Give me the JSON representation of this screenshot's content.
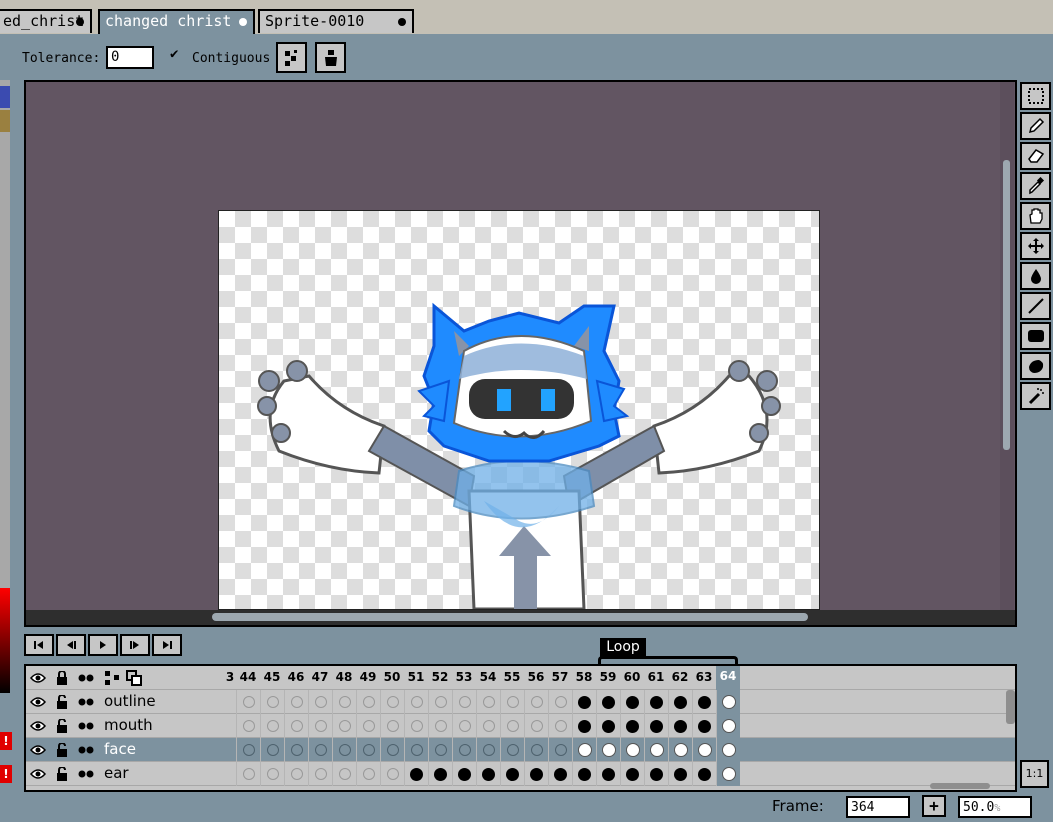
{
  "tabs": [
    {
      "label": "ed_christ",
      "modified": true
    },
    {
      "label": "changed christ",
      "modified": true,
      "active": true
    },
    {
      "label": "Sprite-0010",
      "modified": true
    }
  ],
  "toolbar": {
    "tolerance_label": "Tolerance:",
    "tolerance_value": "0",
    "contiguous_checked": true,
    "contiguous_label": "Contiguous",
    "contiguous_mark": "✔"
  },
  "tools": [
    "rectangular-marquee",
    "pencil",
    "eraser",
    "eyedropper",
    "hand",
    "move",
    "paint-bucket",
    "line",
    "rectangle",
    "contour",
    "spray"
  ],
  "playback": [
    "first-frame",
    "previous-frame",
    "play",
    "next-frame",
    "last-frame"
  ],
  "timeline": {
    "tag_label": "Loop",
    "frames_prefix": "3",
    "frames": [
      44,
      45,
      46,
      47,
      48,
      49,
      50,
      51,
      52,
      53,
      54,
      55,
      56,
      57,
      58,
      59,
      60,
      61,
      62,
      63,
      64
    ],
    "current_frame": 64,
    "layers": [
      {
        "name": "outline",
        "selected": false,
        "cels": "eeeeeeeeeeeeeeeffffffw"
      },
      {
        "name": "mouth",
        "selected": false,
        "cels": "eeeeeeeeeeeeeeeffffffw"
      },
      {
        "name": "face",
        "selected": true,
        "cels": "eeeeeeeeeeeeeeewwwwwww"
      },
      {
        "name": "ear",
        "selected": false,
        "cels": "eeeeeeefffffffffffffw"
      }
    ]
  },
  "status": {
    "frame_label": "Frame:",
    "frame_value": "364",
    "add_frame": "+",
    "zoom_value": "50.0",
    "zoom_unit": "%",
    "ratio_label": "1:1"
  },
  "colors": {
    "ui_bg": "#7d929f",
    "canvas_bg": "#625562",
    "button_face": "#c6c6c6",
    "tab_bar": "#c4c0b5",
    "character_blue": "#1f8bff",
    "character_gray": "#7f8fa8"
  }
}
